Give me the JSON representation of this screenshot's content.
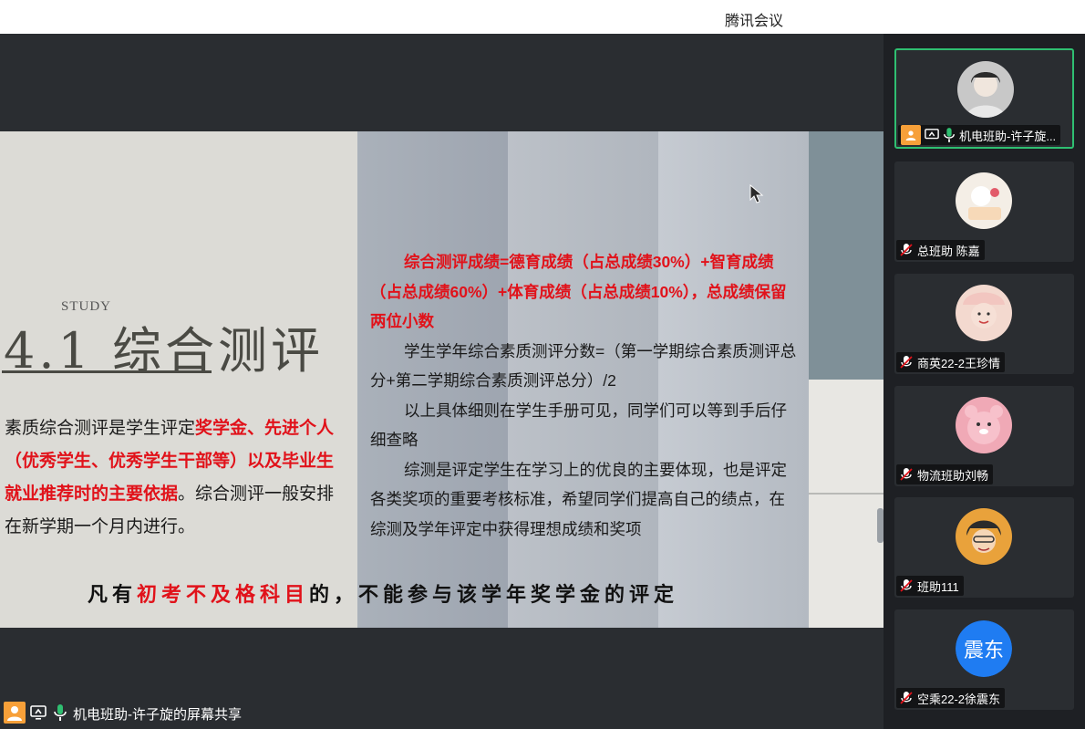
{
  "app": {
    "title": "腾讯会议"
  },
  "slide": {
    "study_label": "STUDY",
    "heading": "4.1  综合测评",
    "left_paragraph": {
      "part1": "素质综合测评是学生评定",
      "part2_red": "奖学金、先进个人（优秀学生、优秀学生干部等）以及毕业生就业推荐时的主要依据",
      "part3": "。综合测评一般安排在新学期一个月内进行。"
    },
    "right_paragraphs": {
      "formula_red": "综合测评成绩=德育成绩（占总成绩30%）+智育成绩（占总成绩60%）+体育成绩（占总成绩10%），总成绩保留两位小数",
      "annual_score": "学生学年综合素质测评分数=（第一学期综合素质测评总分+第二学期综合素质测评总分）/2",
      "handbook": "以上具体细则在学生手册可见，同学们可以等到手后仔细查略",
      "importance": "综测是评定学生在学习上的优良的主要体现，也是评定各类奖项的重要考核标准，希望同学们提高自己的绩点，在综测及学年评定中获得理想成绩和奖项"
    },
    "notice": {
      "prefix": "凡有",
      "red": "初考不及格科目",
      "suffix": "的，不能参与该学年奖学金的评定"
    }
  },
  "share_bar": {
    "label": "机电班助-许子旋的屏幕共享"
  },
  "participants": [
    {
      "name": "机电班助-许子旋...",
      "muted": false,
      "host": true,
      "sharing": true
    },
    {
      "name": "总班助 陈嘉",
      "muted": true
    },
    {
      "name": "商英22-2王珍情",
      "muted": true
    },
    {
      "name": "物流班助刘畅",
      "muted": true
    },
    {
      "name": "班助111",
      "muted": true
    },
    {
      "name": "空乘22-2徐震东",
      "muted": true,
      "avatar_text": "震东"
    }
  ],
  "colors": {
    "accent_red": "#e1121a",
    "active_border": "#2fbf71",
    "host_orange": "#f7a039",
    "avatar_blue": "#1f7cf2"
  }
}
